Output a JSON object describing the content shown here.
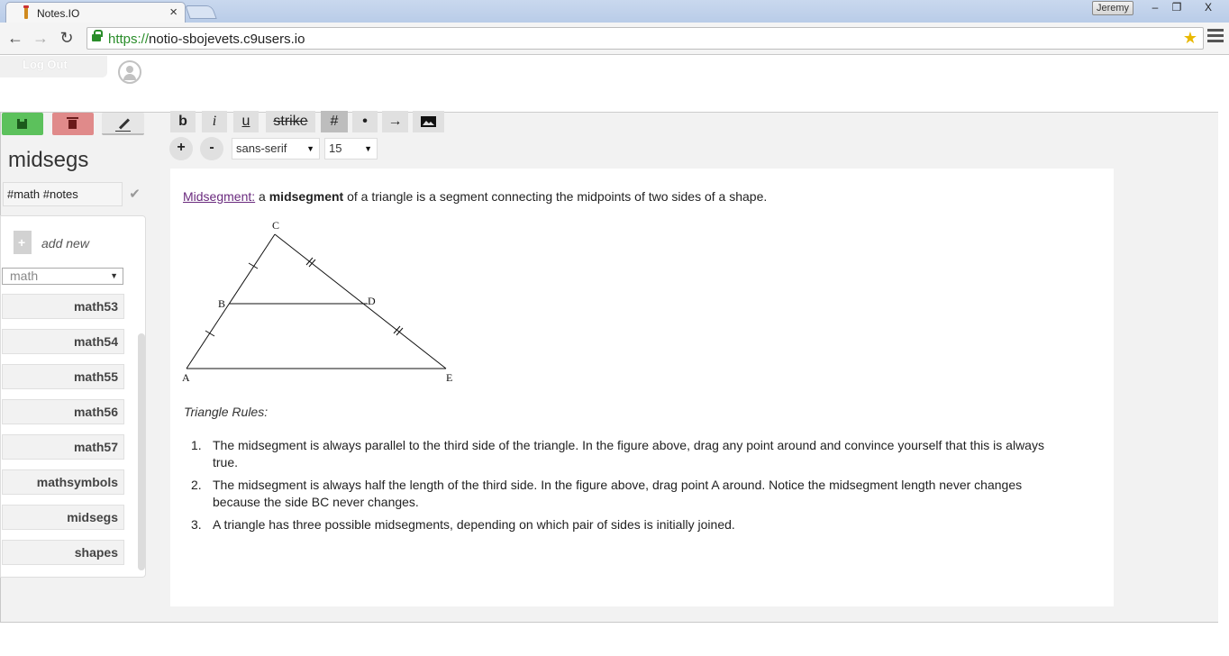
{
  "browser": {
    "tab_title": "Notes.IO",
    "tab_close": "×",
    "user_name": "Jeremy",
    "window_minimize": "‒",
    "window_restore": "❐",
    "window_close": "X",
    "back": "←",
    "forward": "→",
    "reload": "↻",
    "url_scheme": "https://",
    "url_host": "notio-sbojevets.c9users.io",
    "bookmark_star": "★"
  },
  "header": {
    "logout_label": "Log Out",
    "avatar_icon": "user-icon"
  },
  "sidebar": {
    "actions": [
      {
        "name": "save",
        "icon": "save-icon",
        "color": "#5cc15c"
      },
      {
        "name": "delete",
        "icon": "trash-icon",
        "color": "#e08a8a"
      },
      {
        "name": "edit",
        "icon": "pencil-icon",
        "color": "#e6e6e6"
      }
    ],
    "note_title": "midsegs",
    "tags_value": "#math #notes",
    "tags_confirm": "✔",
    "add_new_label": "add new",
    "filter_value": "math",
    "filter_arrow": "▼",
    "notes": [
      "math53",
      "math54",
      "math55",
      "math56",
      "math57",
      "mathsymbols",
      "midsegs",
      "shapes"
    ]
  },
  "toolbar": {
    "bold": "b",
    "italic": "i",
    "underline": "u",
    "strike": "strike",
    "numbered": "#",
    "bullet": "•",
    "indent": "→",
    "image_icon": "image-icon",
    "size_up": "+",
    "size_down": "-",
    "font_family": "sans-serif",
    "font_size": "15",
    "dd_arrow": "▼"
  },
  "document": {
    "intro_link": "Midsegment:",
    "intro_a": " a ",
    "intro_bold": "midsegment",
    "intro_rest": " of a triangle is a segment connecting the midpoints of two sides of a shape.",
    "figure_labels": {
      "A": "A",
      "B": "B",
      "C": "C",
      "D": "D",
      "E": "E"
    },
    "rules_heading": "Triangle Rules:",
    "rules": [
      "The midsegment is always parallel to the third side of the triangle. In the figure above, drag any point around and convince yourself that this is always true.",
      "The midsegment is always half the length of the third side. In the figure above, drag point A around. Notice the midsegment length never changes because the side BC never changes.",
      "A triangle has three possible midsegments, depending on which pair of sides is initially joined."
    ],
    "rule_numbers": [
      "1.",
      "2.",
      "3."
    ]
  }
}
